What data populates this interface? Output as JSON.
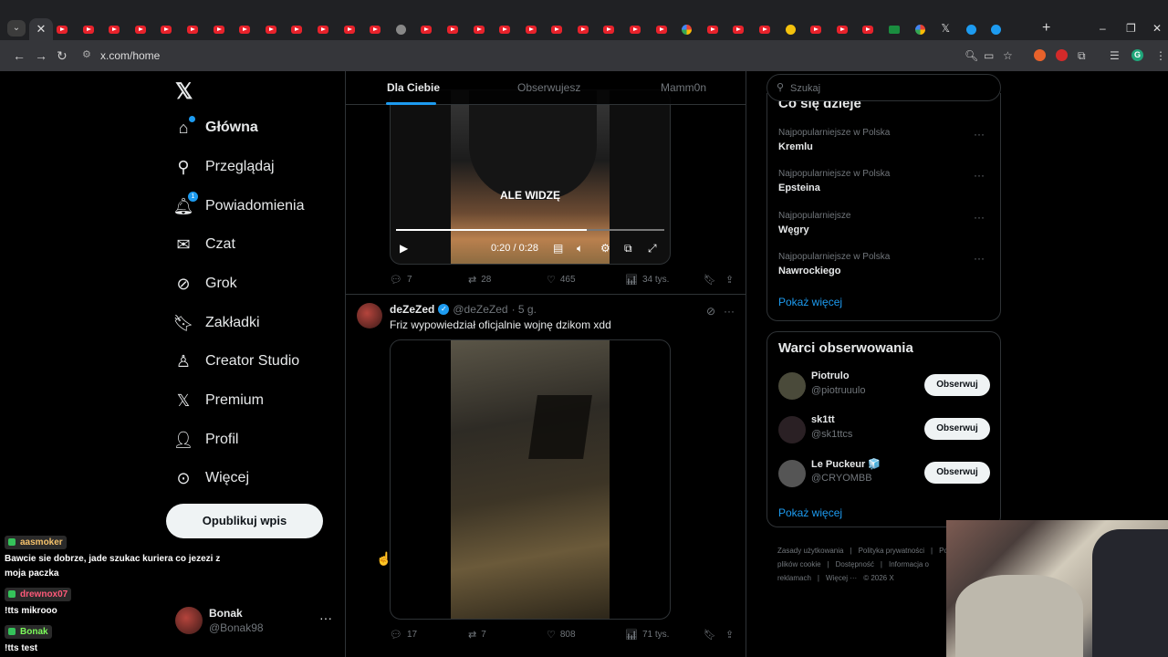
{
  "browser": {
    "url": "x.com/home",
    "tab_close_glyph": "✕",
    "new_tab_glyph": "+",
    "window_buttons": [
      "–",
      "❐",
      "✕"
    ],
    "profile_initial": "G"
  },
  "nav": {
    "items": [
      {
        "label": "Główna",
        "icon": "home-icon"
      },
      {
        "label": "Przeglądaj",
        "icon": "search-icon"
      },
      {
        "label": "Powiadomienia",
        "icon": "bell-icon",
        "badge": "1"
      },
      {
        "label": "Czat",
        "icon": "mail-icon"
      },
      {
        "label": "Grok",
        "icon": "grok-icon"
      },
      {
        "label": "Zakładki",
        "icon": "bookmark-icon"
      },
      {
        "label": "Creator Studio",
        "icon": "creator-studio-icon"
      },
      {
        "label": "Premium",
        "icon": "x-premium-icon"
      },
      {
        "label": "Profil",
        "icon": "person-icon"
      },
      {
        "label": "Więcej",
        "icon": "more-circle-icon"
      }
    ],
    "publish_label": "Opublikuj wpis",
    "user": {
      "name": "Bonak",
      "handle": "@Bonak98",
      "more": "···"
    }
  },
  "feed": {
    "tabs": [
      "Dla Ciebie",
      "Obserwujesz",
      "Mamm0n"
    ],
    "post1": {
      "caption": "ALE WIDZĘ",
      "time": "0:20 / 0:28",
      "progress": 0.71,
      "replies": "7",
      "reposts": "28",
      "likes": "465",
      "views": "34 tys."
    },
    "post2": {
      "name": "deZeZed",
      "handle": "@deZeZed",
      "time": "· 5 g.",
      "text": "Friz wypowiedział oficjalnie wojnę dzikom xdd",
      "replies": "17",
      "reposts": "7",
      "likes": "808",
      "views": "71 tys."
    }
  },
  "sidebar": {
    "search_placeholder": "Szukaj",
    "trends_title": "Co się dzieje",
    "trends": [
      {
        "context": "Najpopularniejsze w Polska",
        "title": "Kremlu"
      },
      {
        "context": "Najpopularniejsze w Polska",
        "title": "Epsteina"
      },
      {
        "context": "Najpopularniejsze",
        "title": "Węgry"
      },
      {
        "context": "Najpopularniejsze w Polska",
        "title": "Nawrockiego"
      }
    ],
    "show_more": "Pokaż więcej",
    "follow_title": "Warci obserwowania",
    "follow": [
      {
        "name": "Piotrulo",
        "handle": "@piotruuulo",
        "button": "Obserwuj",
        "color": "#4a4a3a"
      },
      {
        "name": "sk1tt",
        "handle": "@sk1ttcs",
        "button": "Obserwuj",
        "color": "#2a2024"
      },
      {
        "name": "Le Puckeur 🧊",
        "handle": "@CRYOMBB",
        "button": "Obserwuj",
        "color": "#555555"
      }
    ],
    "footer": [
      "Zasady użytkowania",
      "|",
      "Polityka prywatności",
      "|",
      "Polityka dotycząca plików cookie",
      "|",
      "Dostępność",
      "|",
      "Informacja o reklamach",
      "|",
      "Więcej ···",
      "© 2026 X"
    ]
  },
  "chat": [
    {
      "user": "aasmoker",
      "color": "#f5c26b",
      "text": "Bawcie sie dobrze, jade szukac kuriera co jezezi z moja paczka"
    },
    {
      "user": "drewnox07",
      "color": "#ff5a7a",
      "text": "!tts mikrooo"
    },
    {
      "user": "Bonak",
      "color": "#7cfc5a",
      "text": "!tts test"
    }
  ]
}
